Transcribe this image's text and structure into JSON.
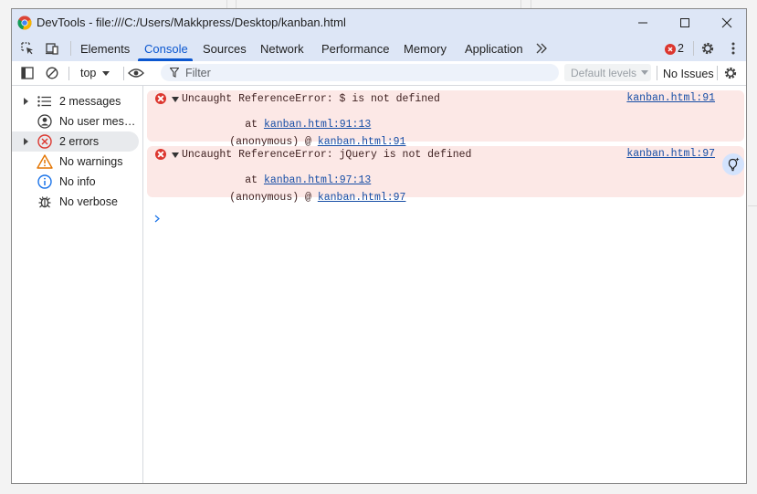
{
  "window": {
    "title": "DevTools - file:///C:/Users/Makkpress/Desktop/kanban.html"
  },
  "tabs": [
    {
      "label": "Elements"
    },
    {
      "label": "Console",
      "active": true
    },
    {
      "label": "Sources"
    },
    {
      "label": "Network"
    },
    {
      "label": "Performance"
    },
    {
      "label": "Memory"
    },
    {
      "label": "Application"
    }
  ],
  "error_badge": {
    "count": "2"
  },
  "toolbar": {
    "context": "top",
    "filter_placeholder": "Filter",
    "levels": "Default levels",
    "issues": "No Issues"
  },
  "sidebar": {
    "items": [
      {
        "label": "2 messages",
        "icon": "list-icon"
      },
      {
        "label": "No user mess...",
        "icon": "user-icon"
      },
      {
        "label": "2 errors",
        "icon": "error-icon",
        "selected": true
      },
      {
        "label": "No warnings",
        "icon": "warning-icon"
      },
      {
        "label": "No info",
        "icon": "info-icon"
      },
      {
        "label": "No verbose",
        "icon": "bug-icon"
      }
    ]
  },
  "messages": [
    {
      "text": "Uncaught ReferenceError: $ is not defined",
      "at_prefix": "at ",
      "at_link": "kanban.html:91:13",
      "anon_prefix": "(anonymous) @ ",
      "anon_link": "kanban.html:91",
      "source": "kanban.html:91"
    },
    {
      "text": "Uncaught ReferenceError: jQuery is not defined",
      "at_prefix": "at ",
      "at_link": "kanban.html:97:13",
      "anon_prefix": "(anonymous) @ ",
      "anon_link": "kanban.html:97",
      "source": "kanban.html:97"
    }
  ],
  "colors": {
    "accent": "#0b57d0",
    "error": "#dc362e",
    "error_bg": "#fce8e6",
    "titlebar": "#dde6f6"
  }
}
